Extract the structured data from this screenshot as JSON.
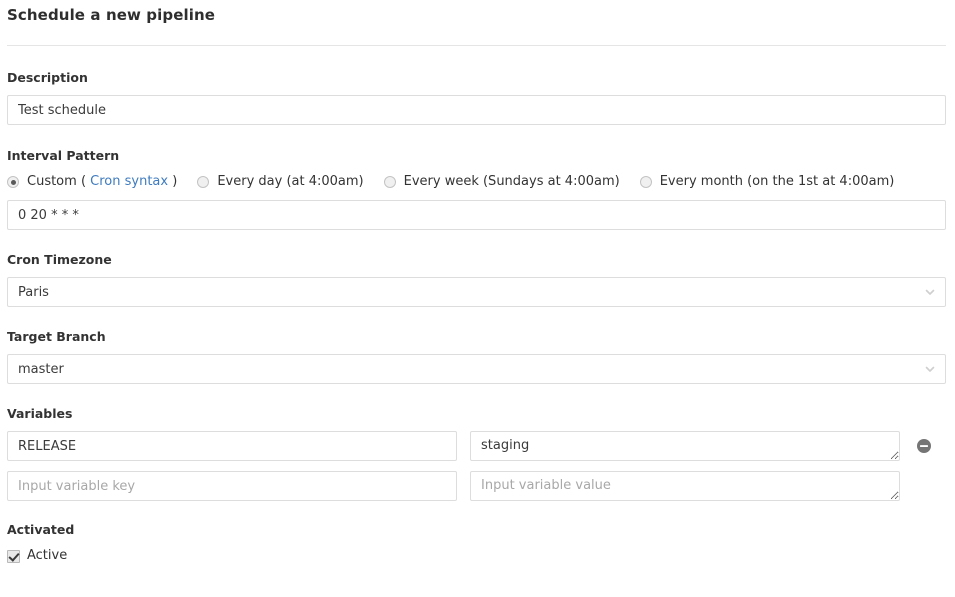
{
  "page": {
    "title": "Schedule a new pipeline"
  },
  "description": {
    "label": "Description",
    "value": "Test schedule",
    "placeholder": ""
  },
  "interval": {
    "label": "Interval Pattern",
    "options": [
      {
        "label": "Custom",
        "link_text": "Cron syntax",
        "open_paren": "(",
        "close_paren": ")",
        "checked": true
      },
      {
        "label": "Every day (at 4:00am)",
        "checked": false
      },
      {
        "label": "Every week (Sundays at 4:00am)",
        "checked": false
      },
      {
        "label": "Every month (on the 1st at 4:00am)",
        "checked": false
      }
    ],
    "cron_value": "0 20 * * *",
    "cron_placeholder": ""
  },
  "timezone": {
    "label": "Cron Timezone",
    "value": "Paris",
    "icon": "chevron-down-icon"
  },
  "branch": {
    "label": "Target Branch",
    "value": "master",
    "icon": "chevron-down-icon"
  },
  "variables": {
    "label": "Variables",
    "rows": [
      {
        "key": "RELEASE",
        "value": "staging",
        "key_placeholder": "Input variable key",
        "value_placeholder": "Input variable value",
        "removable": true,
        "remove_icon": "minus-circle-icon"
      },
      {
        "key": "",
        "value": "",
        "key_placeholder": "Input variable key",
        "value_placeholder": "Input variable value",
        "removable": false,
        "remove_icon": ""
      }
    ]
  },
  "activated": {
    "label": "Activated",
    "checkbox_label": "Active",
    "checked": true
  },
  "colors": {
    "link": "#3f7bbf",
    "label_text": "#333333",
    "border": "#dddddd",
    "placeholder": "#a8a8a8",
    "divider": "#e5e5e5"
  }
}
